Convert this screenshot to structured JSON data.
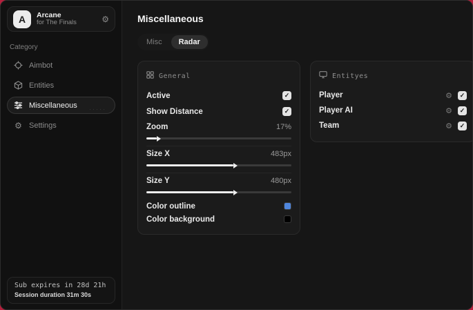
{
  "app": {
    "name": "Arcane",
    "subtitle": "for The Finals"
  },
  "sidebar": {
    "category_label": "Category",
    "items": [
      {
        "label": "Aimbot",
        "icon": "crosshair-icon",
        "selected": false
      },
      {
        "label": "Entities",
        "icon": "cube-icon",
        "selected": false
      },
      {
        "label": "Miscellaneous",
        "icon": "sliders-icon",
        "selected": true
      },
      {
        "label": "Settings",
        "icon": "gear-icon",
        "selected": false
      }
    ],
    "footer": {
      "sub_expires": "Sub expires in 28d 21h",
      "session_duration": "Session duration 31m 30s"
    }
  },
  "main": {
    "title": "Miscellaneous",
    "tabs": [
      {
        "label": "Misc",
        "active": false
      },
      {
        "label": "Radar",
        "active": true
      }
    ]
  },
  "general_panel": {
    "title": "General",
    "toggles": [
      {
        "label": "Active",
        "checked": true
      },
      {
        "label": "Show Distance",
        "checked": true
      }
    ],
    "sliders": [
      {
        "label": "Zoom",
        "value": "17%",
        "fill_pct": 7
      },
      {
        "label": "Size X",
        "value": "483px",
        "fill_pct": 60
      },
      {
        "label": "Size Y",
        "value": "480px",
        "fill_pct": 60
      }
    ],
    "colors": [
      {
        "label": "Color outline",
        "swatch": "#4f86dd"
      },
      {
        "label": "Color background",
        "swatch": "#000000"
      }
    ]
  },
  "entities_panel": {
    "title": "Entityes",
    "rows": [
      {
        "label": "Player",
        "checked": true
      },
      {
        "label": "Player AI",
        "checked": true
      },
      {
        "label": "Team",
        "checked": true
      }
    ]
  },
  "colors": {
    "accent_edge": "#b51f3c",
    "outline_swatch": "#4f86dd",
    "background_swatch": "#000000"
  }
}
